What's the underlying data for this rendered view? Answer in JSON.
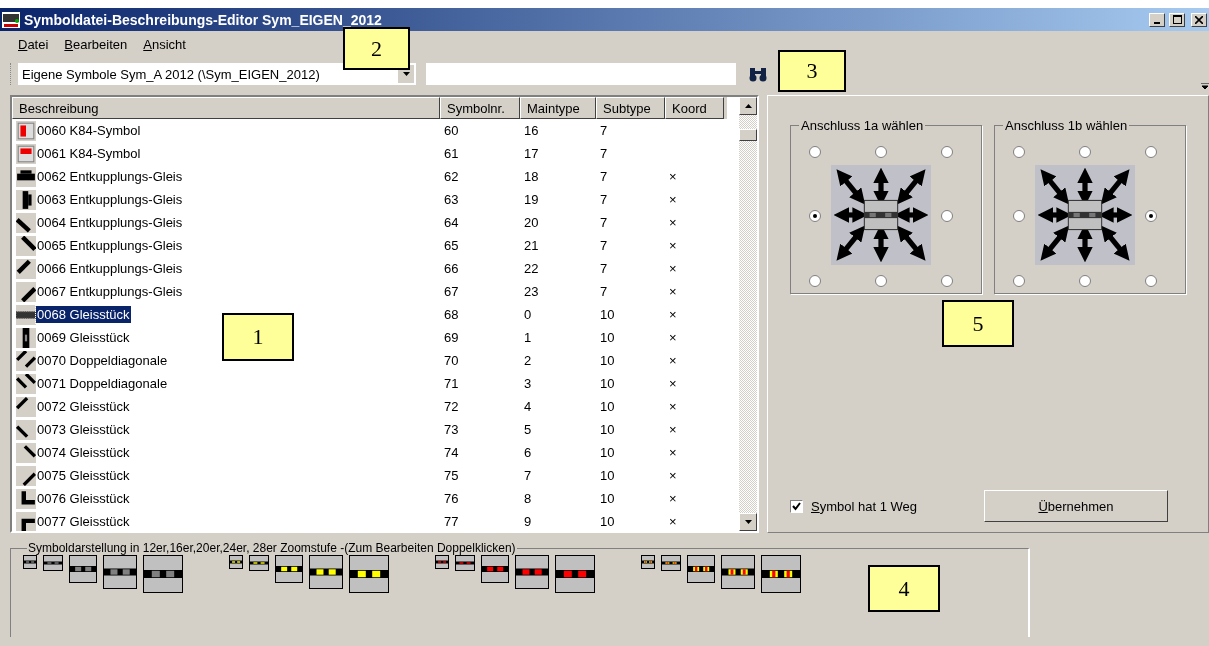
{
  "window": {
    "title": "Symboldatei-Beschreibungs-Editor Sym_EIGEN_2012"
  },
  "menu": [
    "Datei",
    "Bearbeiten",
    "Ansicht"
  ],
  "toolbar": {
    "file_select": "Eigene Symbole Sym_A 2012  (\\Sym_EIGEN_2012)"
  },
  "table": {
    "columns": [
      "Beschreibung",
      "Symbolnr.",
      "Maintype",
      "Subtype",
      "Koord"
    ],
    "rows": [
      {
        "name": "0060 K84-Symbol",
        "symbol": "60",
        "maintype": "16",
        "subtype": "7",
        "selected": false
      },
      {
        "name": "0061 K84-Symbol",
        "symbol": "61",
        "maintype": "17",
        "subtype": "7",
        "selected": false
      },
      {
        "name": "0062 Entkupplungs-Gleis",
        "symbol": "62",
        "maintype": "18",
        "subtype": "7",
        "koord": "×",
        "selected": false
      },
      {
        "name": "0063 Entkupplungs-Gleis",
        "symbol": "63",
        "maintype": "19",
        "subtype": "7",
        "koord": "×",
        "selected": false
      },
      {
        "name": "0064 Entkupplungs-Gleis",
        "symbol": "64",
        "maintype": "20",
        "subtype": "7",
        "koord": "×",
        "selected": false
      },
      {
        "name": "0065 Entkupplungs-Gleis",
        "symbol": "65",
        "maintype": "21",
        "subtype": "7",
        "koord": "×",
        "selected": false
      },
      {
        "name": "0066 Entkupplungs-Gleis",
        "symbol": "66",
        "maintype": "22",
        "subtype": "7",
        "koord": "×",
        "selected": false
      },
      {
        "name": "0067 Entkupplungs-Gleis",
        "symbol": "67",
        "maintype": "23",
        "subtype": "7",
        "koord": "×",
        "selected": false
      },
      {
        "name": "0068 Gleisstück",
        "symbol": "68",
        "maintype": "0",
        "subtype": "10",
        "koord": "×",
        "selected": true
      },
      {
        "name": "0069 Gleisstück",
        "symbol": "69",
        "maintype": "1",
        "subtype": "10",
        "koord": "×",
        "selected": false
      },
      {
        "name": "0070 Doppeldiagonale",
        "symbol": "70",
        "maintype": "2",
        "subtype": "10",
        "koord": "×",
        "selected": false
      },
      {
        "name": "0071 Doppeldiagonale",
        "symbol": "71",
        "maintype": "3",
        "subtype": "10",
        "koord": "×",
        "selected": false
      },
      {
        "name": "0072 Gleisstück",
        "symbol": "72",
        "maintype": "4",
        "subtype": "10",
        "koord": "×",
        "selected": false
      },
      {
        "name": "0073 Gleisstück",
        "symbol": "73",
        "maintype": "5",
        "subtype": "10",
        "koord": "×",
        "selected": false
      },
      {
        "name": "0074 Gleisstück",
        "symbol": "74",
        "maintype": "6",
        "subtype": "10",
        "koord": "×",
        "selected": false
      },
      {
        "name": "0075 Gleisstück",
        "symbol": "75",
        "maintype": "7",
        "subtype": "10",
        "koord": "×",
        "selected": false
      },
      {
        "name": "0076 Gleisstück",
        "symbol": "76",
        "maintype": "8",
        "subtype": "10",
        "koord": "×",
        "selected": false
      },
      {
        "name": "0077 Gleisstück",
        "symbol": "77",
        "maintype": "9",
        "subtype": "10",
        "koord": "×",
        "selected": false
      }
    ]
  },
  "connections": [
    {
      "title": "Anschluss 1a wählen",
      "options": [
        {
          "selected": false
        },
        {
          "selected": false
        },
        {
          "selected": false
        },
        {
          "selected": true
        },
        {
          "selected": false
        },
        {
          "selected": false
        },
        {
          "selected": false
        },
        {
          "selected": false
        }
      ]
    },
    {
      "title": "Anschluss 1b wählen",
      "options": [
        {
          "selected": false
        },
        {
          "selected": false
        },
        {
          "selected": false
        },
        {
          "selected": false
        },
        {
          "selected": true
        },
        {
          "selected": false
        },
        {
          "selected": false
        },
        {
          "selected": false
        }
      ]
    }
  ],
  "one_way": {
    "label": "Symbol hat 1 Weg",
    "checked": true
  },
  "apply_button": "Übernehmen",
  "zoom_strip": {
    "caption": "Symboldarstellung in 12er,16er,20er,24er, 28er Zoomstufe -(Zum Bearbeiten Doppelklicken)",
    "groups": [
      {
        "color": "#808080"
      },
      {
        "color": "#ffff00"
      },
      {
        "color": "#ff0000"
      },
      {
        "color": "#ffff00",
        "stripe": {
          "color": "#ff0000"
        }
      }
    ]
  },
  "callouts": [
    "1",
    "2",
    "3",
    "4",
    "5"
  ]
}
